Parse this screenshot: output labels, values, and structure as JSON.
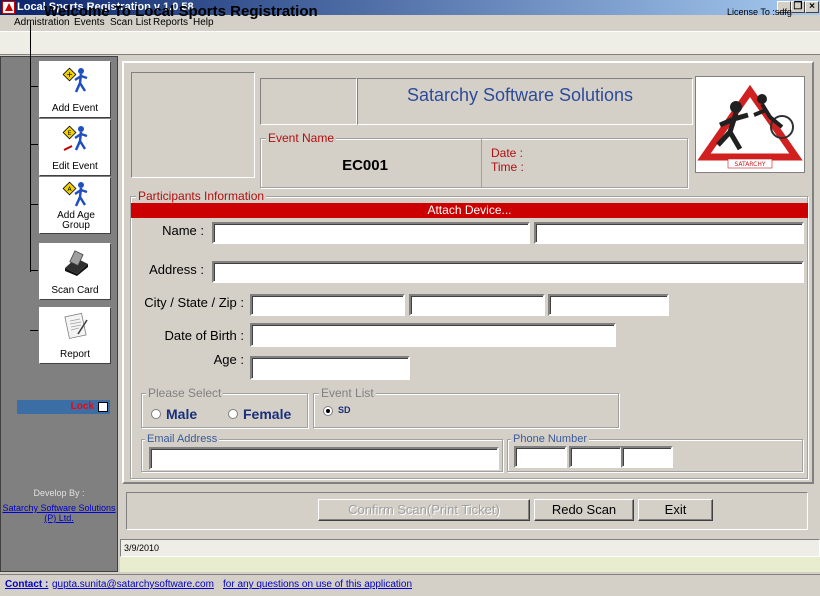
{
  "window": {
    "title": "Local Sports Registration v 1.0.58",
    "minimize": "_",
    "restore": "❐",
    "close": "×"
  },
  "menu": [
    "Admistration",
    "Events",
    "Scan List",
    "Reports",
    "Help"
  ],
  "header": {
    "welcome": "Welcome To Local Sports Registration",
    "license": "License To :sdfg"
  },
  "sidebar": {
    "items": [
      {
        "label": "Add Event",
        "icon": "add-event-icon"
      },
      {
        "label": "Edit Event",
        "icon": "edit-event-icon"
      },
      {
        "label": "Add Age Group",
        "icon": "add-age-group-icon"
      },
      {
        "label": "Scan Card",
        "icon": "scan-card-icon"
      },
      {
        "label": "Report",
        "icon": "report-icon"
      }
    ],
    "lock_label": "Lock",
    "developed_by": "Develop By :",
    "developer": "Satarchy Software Solutions (P) Ltd."
  },
  "event": {
    "company": "Satarchy Software Solutions",
    "event_name_legend": "Event Name",
    "event_code": "EC001",
    "date_label": "Date :",
    "time_label": "Time :"
  },
  "participants": {
    "legend": "Participants Information",
    "banner": "Attach Device...",
    "name_label": "Name :",
    "first_name": "",
    "last_name": "",
    "address_label": "Address :",
    "address": "",
    "city_label": "City / State / Zip :",
    "city": "",
    "state": "",
    "zip": "",
    "dob_label": "Date of Birth :",
    "dob": "",
    "age_label": "Age :",
    "age": "",
    "gender_legend": "Please Select",
    "gender_options": [
      "Male",
      "Female"
    ],
    "event_list_legend": "Event List",
    "event_list": [
      "SD"
    ],
    "email_legend": "Email Address",
    "email": "",
    "phone_legend": "Phone Number",
    "phone": [
      "",
      "",
      ""
    ]
  },
  "buttons": {
    "confirm": "Confirm Scan(Print Ticket)",
    "redo": "Redo Scan",
    "exit": "Exit"
  },
  "status": {
    "date": "3/9/2010"
  },
  "footer": {
    "contact_label": "Contact :",
    "email": "gupta.sunita@satarchysoftware.com",
    "note": "for any questions on use of this application"
  },
  "colors": {
    "accent_red": "#cc0000",
    "company_blue": "#2e4b9a",
    "title_bar": "#0a246a"
  }
}
